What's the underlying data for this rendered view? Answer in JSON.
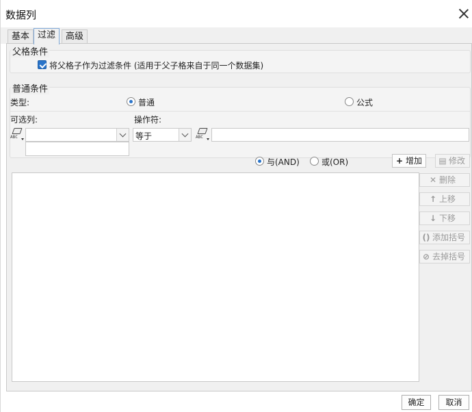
{
  "dialog": {
    "title": "数据列",
    "tabs": [
      {
        "label": "基本",
        "active": false
      },
      {
        "label": "过滤",
        "active": true
      },
      {
        "label": "高级",
        "active": false
      }
    ]
  },
  "parent_condition": {
    "group_label": "父格条件",
    "checkbox_label": "将父格子作为过滤条件 (适用于父子格来自于同一个数据集)",
    "checked": true
  },
  "normal_condition": {
    "group_label": "普通条件",
    "type_label": "类型:",
    "type_options": [
      {
        "label": "普通",
        "selected": true
      },
      {
        "label": "公式",
        "selected": false
      }
    ],
    "columns_label": "可选列:",
    "columns_value": "",
    "operator_label": "操作符:",
    "operator_value": "等于",
    "value_input": "",
    "abc_icon_text": "ABC"
  },
  "logic": {
    "and_label": "与(AND)",
    "or_label": "或(OR)",
    "and_selected": true
  },
  "buttons": {
    "add": "增加",
    "modify": "修改",
    "delete": "删除",
    "move_up": "上移",
    "move_down": "下移",
    "add_bracket": "添加括号",
    "remove_bracket": "去掉括号"
  },
  "footer": {
    "ok": "确定",
    "cancel": "取消"
  },
  "colors": {
    "accent": "#2a74c9",
    "panel_bg": "#f0f0f0"
  }
}
